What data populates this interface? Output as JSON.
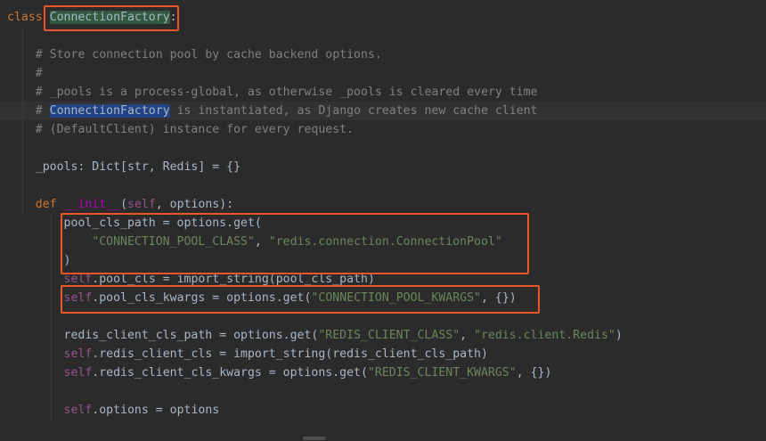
{
  "editor": {
    "lines": [
      {
        "segments": [
          {
            "t": "class",
            "c": "kw"
          },
          {
            "t": " "
          },
          {
            "t": "ConnectionFactory",
            "c": "hl-green"
          },
          {
            "t": ":"
          }
        ]
      },
      {
        "segments": []
      },
      {
        "segments": [
          {
            "t": "    "
          },
          {
            "t": "# Store connection pool by cache backend options.",
            "c": "cmt"
          }
        ]
      },
      {
        "segments": [
          {
            "t": "    "
          },
          {
            "t": "#",
            "c": "cmt"
          }
        ]
      },
      {
        "segments": [
          {
            "t": "    "
          },
          {
            "t": "# _pools is a process-global, as otherwise _pools is cleared every time",
            "c": "cmt"
          }
        ]
      },
      {
        "segments": [
          {
            "t": "    "
          },
          {
            "t": "# ",
            "c": "cmt"
          },
          {
            "t": "ConnectionFactory",
            "c": "hl-blue"
          },
          {
            "t": " is instantiated, as Django creates new cache client",
            "c": "cmt"
          }
        ],
        "current": true
      },
      {
        "segments": [
          {
            "t": "    "
          },
          {
            "t": "# (DefaultClient) instance for every request.",
            "c": "cmt"
          }
        ]
      },
      {
        "segments": []
      },
      {
        "segments": [
          {
            "t": "    _pools: Dict[str, Redis] = {}"
          }
        ]
      },
      {
        "segments": []
      },
      {
        "segments": [
          {
            "t": "    "
          },
          {
            "t": "def",
            "c": "kw"
          },
          {
            "t": " "
          },
          {
            "t": "__init__",
            "c": "magic"
          },
          {
            "t": "("
          },
          {
            "t": "self",
            "c": "self"
          },
          {
            "t": ", options):"
          }
        ]
      },
      {
        "segments": [
          {
            "t": "        pool_cls_path = options.get("
          }
        ]
      },
      {
        "segments": [
          {
            "t": "            "
          },
          {
            "t": "\"CONNECTION_POOL_CLASS\"",
            "c": "str"
          },
          {
            "t": ", "
          },
          {
            "t": "\"redis.connection.ConnectionPool\"",
            "c": "str"
          }
        ]
      },
      {
        "segments": [
          {
            "t": "        )"
          }
        ]
      },
      {
        "segments": [
          {
            "t": "        "
          },
          {
            "t": "self",
            "c": "self"
          },
          {
            "t": ".pool_cls = import_string(pool_cls_path)"
          }
        ]
      },
      {
        "segments": [
          {
            "t": "        "
          },
          {
            "t": "self",
            "c": "self"
          },
          {
            "t": ".pool_cls_kwargs = options.get("
          },
          {
            "t": "\"CONNECTION_POOL_KWARGS\"",
            "c": "str"
          },
          {
            "t": ", {})"
          }
        ]
      },
      {
        "segments": []
      },
      {
        "segments": [
          {
            "t": "        redis_client_cls_path = options.get("
          },
          {
            "t": "\"REDIS_CLIENT_CLASS\"",
            "c": "str"
          },
          {
            "t": ", "
          },
          {
            "t": "\"redis.client.Redis\"",
            "c": "str"
          },
          {
            "t": ")"
          }
        ]
      },
      {
        "segments": [
          {
            "t": "        "
          },
          {
            "t": "self",
            "c": "self"
          },
          {
            "t": ".redis_client_cls = import_string(redis_client_cls_path)"
          }
        ]
      },
      {
        "segments": [
          {
            "t": "        "
          },
          {
            "t": "self",
            "c": "self"
          },
          {
            "t": ".redis_client_cls_kwargs = options.get("
          },
          {
            "t": "\"REDIS_CLIENT_KWARGS\"",
            "c": "str"
          },
          {
            "t": ", {})"
          }
        ]
      },
      {
        "segments": []
      },
      {
        "segments": [
          {
            "t": "        "
          },
          {
            "t": "self",
            "c": "self"
          },
          {
            "t": ".options = options"
          }
        ]
      }
    ]
  },
  "colors": {
    "background": "#2b2b2b",
    "keyword": "#cc7832",
    "self": "#94558d",
    "string": "#6a8759",
    "comment": "#808080",
    "magic": "#b200b2",
    "annotation_frame": "#e8562a"
  }
}
